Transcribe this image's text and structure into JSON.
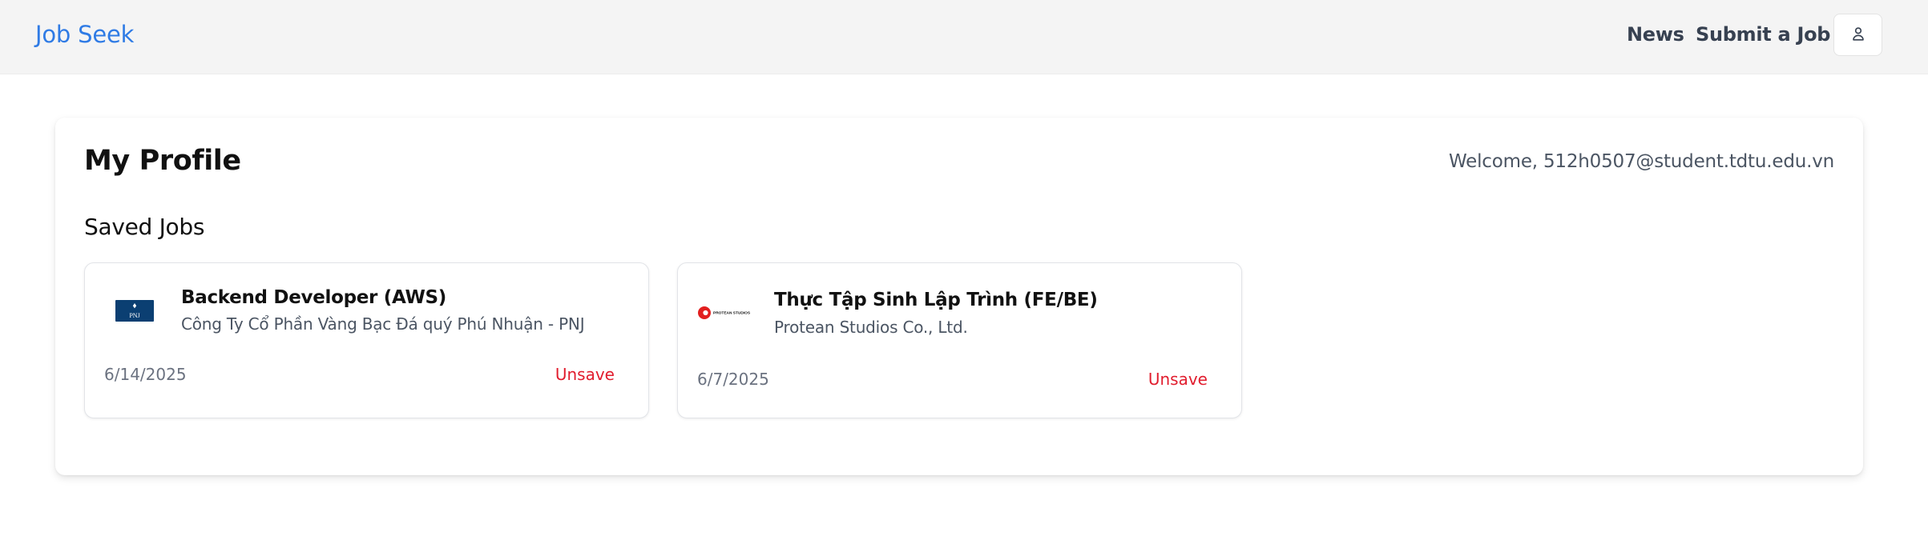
{
  "header": {
    "brand": "Job Seek",
    "nav": {
      "news": "News",
      "submit_job": "Submit a Job"
    },
    "user_icon": "user-icon"
  },
  "profile": {
    "title": "My Profile",
    "welcome": "Welcome, 512h0507@student.tdtu.edu.vn",
    "saved_jobs_title": "Saved Jobs",
    "saved_jobs": [
      {
        "title": "Backend Developer (AWS)",
        "company": "Công Ty Cổ Phần Vàng Bạc Đá quý Phú Nhuận - PNJ",
        "date": "6/14/2025",
        "action": "Unsave",
        "logo": "PNJ"
      },
      {
        "title": "Thực Tập Sinh Lập Trình (FE/BE)",
        "company": "Protean Studios Co., Ltd.",
        "date": "6/7/2025",
        "action": "Unsave",
        "logo": "PROTEAN STUDIOS"
      }
    ]
  },
  "colors": {
    "brand": "#2f7be5",
    "danger": "#e11d2e",
    "nav_bg": "#f4f4f4",
    "pnj_blue": "#0b3f72"
  }
}
